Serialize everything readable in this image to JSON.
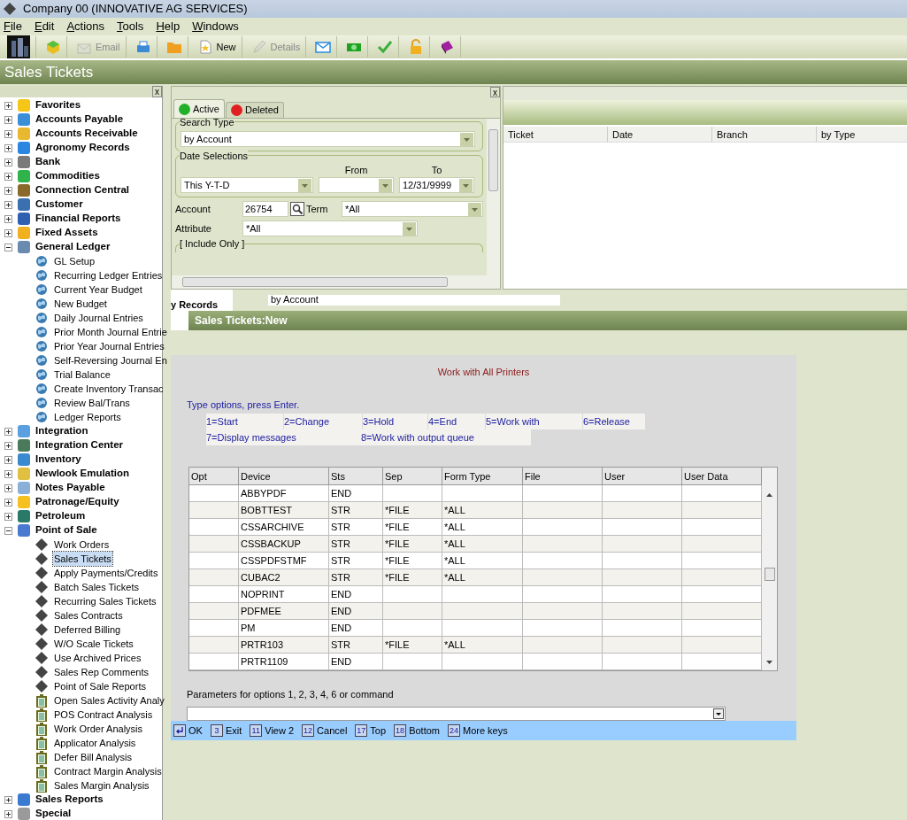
{
  "window": {
    "title": "Company 00 (INNOVATIVE AG SERVICES)"
  },
  "menu": [
    "File",
    "Edit",
    "Actions",
    "Tools",
    "Help",
    "Windows"
  ],
  "toolbar": [
    {
      "kind": "logo",
      "disabled": false
    },
    {
      "kind": "cube",
      "disabled": false
    },
    {
      "kind": "email",
      "label": "Email",
      "disabled": true
    },
    {
      "kind": "printer",
      "disabled": false
    },
    {
      "kind": "folder",
      "disabled": false
    },
    {
      "kind": "new",
      "label": "New",
      "disabled": false
    },
    {
      "kind": "details",
      "label": "Details",
      "disabled": true
    },
    {
      "kind": "mail",
      "disabled": false
    },
    {
      "kind": "money",
      "disabled": false
    },
    {
      "kind": "check",
      "disabled": false
    },
    {
      "kind": "lock",
      "disabled": false
    },
    {
      "kind": "book",
      "disabled": false
    }
  ],
  "page_title": "Sales Tickets",
  "sidebar": {
    "close": "x",
    "items": [
      {
        "label": "Favorites",
        "color": "#f5c518",
        "expanded": false
      },
      {
        "label": "Accounts Payable",
        "color": "#3b8fd9",
        "expanded": false
      },
      {
        "label": "Accounts Receivable",
        "color": "#e8b830",
        "expanded": false
      },
      {
        "label": "Agronomy Records",
        "color": "#2a86e0",
        "expanded": false
      },
      {
        "label": "Bank",
        "color": "#7a7a7a",
        "expanded": false
      },
      {
        "label": "Commodities",
        "color": "#2fb34a",
        "expanded": false
      },
      {
        "label": "Connection Central",
        "color": "#8a6a2a",
        "expanded": false
      },
      {
        "label": "Customer",
        "color": "#3a6fb0",
        "expanded": false
      },
      {
        "label": "Financial Reports",
        "color": "#2f5fb0",
        "expanded": false
      },
      {
        "label": "Fixed Assets",
        "color": "#f0b020",
        "expanded": false
      },
      {
        "label": "General Ledger",
        "color": "#6a8ab0",
        "expanded": true,
        "children": [
          {
            "label": "GL Setup",
            "kind": "globe",
            "selected": false
          },
          {
            "label": "Recurring Ledger Entries",
            "kind": "globe",
            "selected": false
          },
          {
            "label": "Current Year Budget",
            "kind": "globe",
            "selected": false
          },
          {
            "label": "New Budget",
            "kind": "globe",
            "selected": false
          },
          {
            "label": "Daily Journal Entries",
            "kind": "globe",
            "selected": false
          },
          {
            "label": "Prior Month Journal Entrie",
            "kind": "globe",
            "selected": false
          },
          {
            "label": "Prior Year Journal Entries",
            "kind": "globe",
            "selected": false
          },
          {
            "label": "Self-Reversing Journal En",
            "kind": "globe",
            "selected": false
          },
          {
            "label": "Trial Balance",
            "kind": "globe",
            "selected": false
          },
          {
            "label": "Create Inventory Transac",
            "kind": "globe",
            "selected": false
          },
          {
            "label": "Review Bal/Trans",
            "kind": "globe",
            "selected": false
          },
          {
            "label": "Ledger Reports",
            "kind": "globe",
            "selected": false
          }
        ]
      },
      {
        "label": "Integration",
        "color": "#5aa0e0",
        "expanded": false
      },
      {
        "label": "Integration Center",
        "color": "#4a7a5a",
        "expanded": false
      },
      {
        "label": "Inventory",
        "color": "#3a8ad0",
        "expanded": false
      },
      {
        "label": "Newlook Emulation",
        "color": "#e0c040",
        "expanded": false
      },
      {
        "label": "Notes Payable",
        "color": "#8ab0d8",
        "expanded": false
      },
      {
        "label": "Patronage/Equity",
        "color": "#f5c020",
        "expanded": false
      },
      {
        "label": "Petroleum",
        "color": "#2a7a6a",
        "expanded": false
      },
      {
        "label": "Point of Sale",
        "color": "#4a7ad0",
        "expanded": true,
        "children": [
          {
            "label": "Work Orders",
            "kind": "diamond",
            "selected": false
          },
          {
            "label": "Sales Tickets",
            "kind": "diamond",
            "selected": true
          },
          {
            "label": "Apply Payments/Credits",
            "kind": "diamond",
            "selected": false
          },
          {
            "label": "Batch Sales Tickets",
            "kind": "diamond",
            "selected": false
          },
          {
            "label": "Recurring Sales Tickets",
            "kind": "diamond",
            "selected": false
          },
          {
            "label": "Sales Contracts",
            "kind": "diamond",
            "selected": false
          },
          {
            "label": "Deferred Billing",
            "kind": "diamond",
            "selected": false
          },
          {
            "label": "W/O Scale Tickets",
            "kind": "diamond",
            "selected": false
          },
          {
            "label": "Use Archived Prices",
            "kind": "diamond",
            "selected": false
          },
          {
            "label": "Sales Rep Comments",
            "kind": "diamond",
            "selected": false
          },
          {
            "label": "Point of Sale Reports",
            "kind": "diamond",
            "selected": false
          },
          {
            "label": "Open Sales Activity Analy",
            "kind": "clipboard",
            "selected": false
          },
          {
            "label": "POS Contract Analysis",
            "kind": "clipboard",
            "selected": false
          },
          {
            "label": "Work Order Analysis",
            "kind": "clipboard",
            "selected": false
          },
          {
            "label": "Applicator Analysis",
            "kind": "clipboard",
            "selected": false
          },
          {
            "label": "Defer Bill Analysis",
            "kind": "clipboard",
            "selected": false
          },
          {
            "label": "Contract Margin Analysis",
            "kind": "clipboard",
            "selected": false
          },
          {
            "label": "Sales Margin Analysis",
            "kind": "clipboard",
            "selected": false
          }
        ]
      },
      {
        "label": "Sales Reports",
        "color": "#3a7ad0",
        "expanded": false
      },
      {
        "label": "Special",
        "color": "#9a9a9a",
        "expanded": false
      }
    ]
  },
  "search": {
    "close": "x",
    "tabs": [
      {
        "label": "Active",
        "selected": true,
        "color": "#22b02a"
      },
      {
        "label": "Deleted",
        "selected": false,
        "color": "#e02020"
      }
    ],
    "search_type": {
      "legend": "Search Type",
      "value": "by Account"
    },
    "date_selections": {
      "legend": "Date Selections",
      "from_label": "From",
      "to_label": "To",
      "range": "This Y-T-D",
      "to": "12/31/9999"
    },
    "account": {
      "label": "Account",
      "value": "26754"
    },
    "term": {
      "label": "Term",
      "value": "*All"
    },
    "attribute": {
      "label": "Attribute",
      "value": "*All"
    },
    "include_only": "[ Include Only ]"
  },
  "results": {
    "columns": [
      "Ticket",
      "Date",
      "Branch",
      "by Type"
    ]
  },
  "background_window": {
    "tree_fragment": "y Records",
    "dropdown": "by Account"
  },
  "subwindow": {
    "title": "Sales Tickets:New"
  },
  "terminal": {
    "title": "Work with All Printers",
    "instruction": "Type options, press Enter.",
    "options": [
      [
        "1=Start",
        "2=Change",
        "3=Hold",
        "4=End",
        "5=Work with",
        "6=Release"
      ],
      [
        "7=Display messages",
        "8=Work with output queue"
      ]
    ],
    "columns": [
      "Opt",
      "Device",
      "Sts",
      "Sep",
      "Form Type",
      "File",
      "User",
      "User Data"
    ],
    "rows": [
      [
        "",
        "ABBYPDF",
        "END",
        "",
        "",
        "",
        "",
        ""
      ],
      [
        "",
        "BOBTTEST",
        "STR",
        "*FILE",
        "*ALL",
        "",
        "",
        ""
      ],
      [
        "",
        "CSSARCHIVE",
        "STR",
        "*FILE",
        "*ALL",
        "",
        "",
        ""
      ],
      [
        "",
        "CSSBACKUP",
        "STR",
        "*FILE",
        "*ALL",
        "",
        "",
        ""
      ],
      [
        "",
        "CSSPDFSTMF",
        "STR",
        "*FILE",
        "*ALL",
        "",
        "",
        ""
      ],
      [
        "",
        "CUBAC2",
        "STR",
        "*FILE",
        "*ALL",
        "",
        "",
        ""
      ],
      [
        "",
        "NOPRINT",
        "END",
        "",
        "",
        "",
        "",
        ""
      ],
      [
        "",
        "PDFMEE",
        "END",
        "",
        "",
        "",
        "",
        ""
      ],
      [
        "",
        "PM",
        "END",
        "",
        "",
        "",
        "",
        ""
      ],
      [
        "",
        "PRTR103",
        "STR",
        "*FILE",
        "*ALL",
        "",
        "",
        ""
      ],
      [
        "",
        "PRTR1109",
        "END",
        "",
        "",
        "",
        "",
        ""
      ]
    ],
    "command_label": "Parameters for options 1, 2, 3, 4, 6 or command",
    "keys": [
      {
        "kind": "enter",
        "label": "OK"
      },
      {
        "kind": "number",
        "key": "3",
        "label": "Exit"
      },
      {
        "kind": "number",
        "key": "11",
        "label": "View 2"
      },
      {
        "kind": "number",
        "key": "12",
        "label": "Cancel"
      },
      {
        "kind": "number",
        "key": "17",
        "label": "Top"
      },
      {
        "kind": "number",
        "key": "18",
        "label": "Bottom"
      },
      {
        "kind": "number",
        "key": "24",
        "label": "More keys"
      }
    ]
  }
}
